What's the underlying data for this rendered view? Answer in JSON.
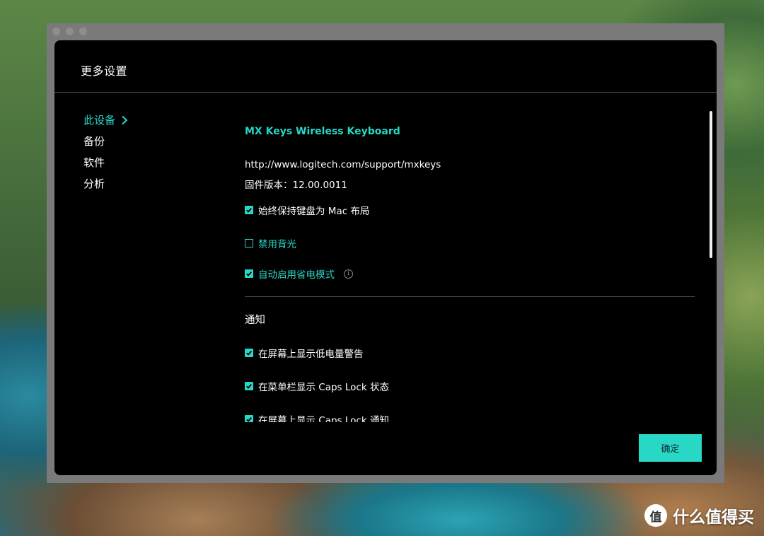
{
  "dialog": {
    "title": "更多设置",
    "confirm_label": "确定"
  },
  "sidebar": {
    "items": [
      {
        "label": "此设备",
        "active": true
      },
      {
        "label": "备份",
        "active": false
      },
      {
        "label": "软件",
        "active": false
      },
      {
        "label": "分析",
        "active": false
      }
    ]
  },
  "device": {
    "name": "MX Keys Wireless Keyboard",
    "support_url": "http://www.logitech.com/support/mxkeys",
    "firmware_label": "固件版本：",
    "firmware_version": "12.00.0011"
  },
  "options": [
    {
      "label": "始终保持键盘为 Mac 布局",
      "checked": true,
      "accent": false
    },
    {
      "label": "禁用背光",
      "checked": false,
      "accent": true
    },
    {
      "label": "自动启用省电模式",
      "checked": true,
      "accent": true,
      "info_icon": "info-icon"
    }
  ],
  "notifications": {
    "heading": "通知",
    "items": [
      {
        "label": "在屏幕上显示低电量警告",
        "checked": true
      },
      {
        "label": "在菜单栏显示 Caps Lock 状态",
        "checked": true
      },
      {
        "label": "在屏幕上显示 Caps Lock 通知",
        "checked": true
      }
    ]
  },
  "watermark": {
    "logo_glyph": "值",
    "text": "什么值得买"
  },
  "colors": {
    "accent": "#28d7c6",
    "dialog_bg": "#000000",
    "frame": "#7a7a7a"
  }
}
